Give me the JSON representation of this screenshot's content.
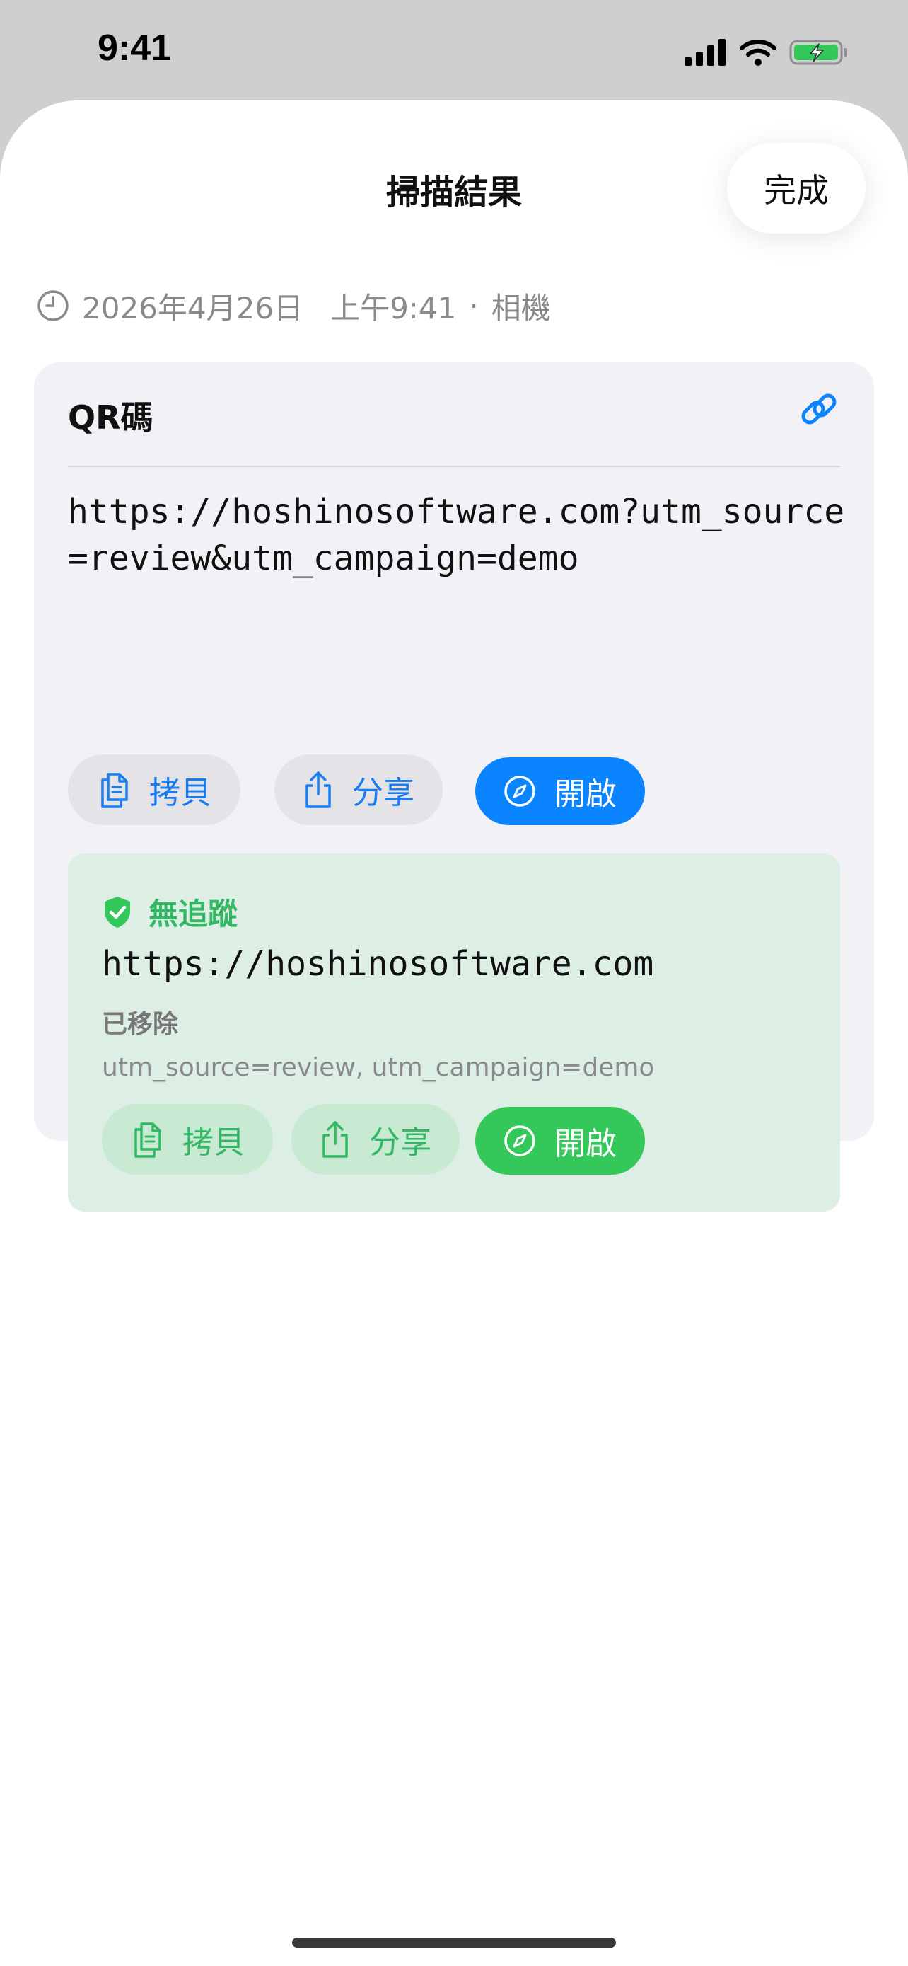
{
  "status_bar": {
    "time": "9:41"
  },
  "sheet": {
    "title": "掃描結果",
    "done_label": "完成"
  },
  "meta": {
    "date": "2026年4月26日",
    "time": "上午9:41",
    "separator": "·",
    "source": "相機"
  },
  "card": {
    "type_label": "QR碼",
    "raw_url": "https://hoshinosoftware.com?utm_source=review&utm_campaign=demo",
    "actions": {
      "copy": "拷貝",
      "share": "分享",
      "open": "開啟"
    }
  },
  "clean": {
    "badge": "無追蹤",
    "url": "https://hoshinosoftware.com",
    "removed_label": "已移除",
    "removed_params": "utm_source=review, utm_campaign=demo",
    "actions": {
      "copy": "拷貝",
      "share": "分享",
      "open": "開啟"
    }
  },
  "colors": {
    "accent": "#0a84ff",
    "success": "#34c759",
    "card_bg": "#f2f2f6",
    "clean_bg": "#ddeee4"
  },
  "icons": [
    "clock-icon",
    "link-icon",
    "copy-icon",
    "share-icon",
    "compass-icon",
    "shield-check-icon"
  ]
}
